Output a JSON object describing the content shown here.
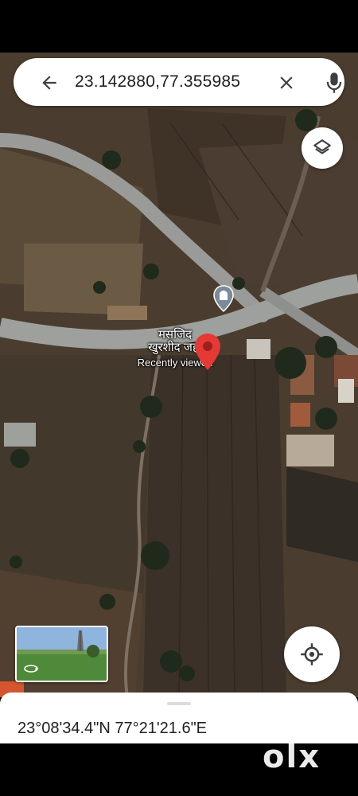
{
  "search": {
    "query": "23.142880,77.355985"
  },
  "map": {
    "place_name_line1": "मसजिद",
    "place_name_line2": "खुरशीद जहाँ",
    "place_status": "Recently viewed",
    "pin_color": "#e53935"
  },
  "bottom_sheet": {
    "coordinates_dms": "23°08'34.4\"N 77°21'21.6\"E"
  },
  "watermark": {
    "text": "olx"
  },
  "icons": {
    "back": "arrow-left-icon",
    "close": "close-icon",
    "mic": "microphone-icon",
    "layers": "layers-icon",
    "locate": "my-location-icon",
    "streetview": "street-view-360-icon",
    "poi": "mosque-poi-icon"
  }
}
